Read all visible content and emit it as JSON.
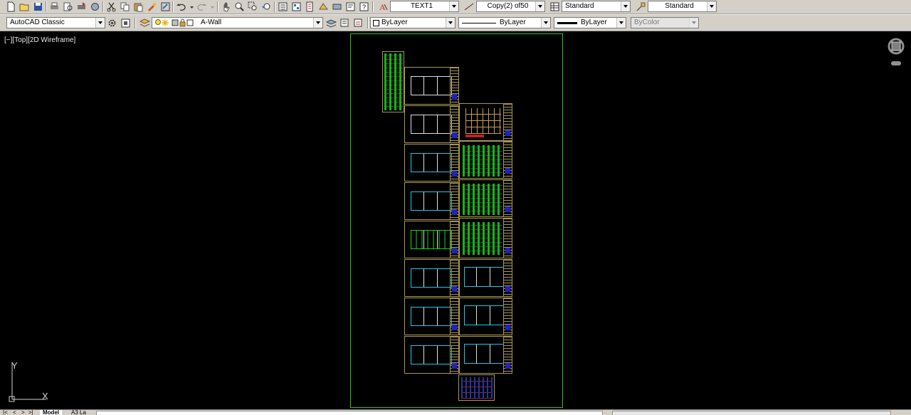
{
  "toolbar1": {
    "text_style": "TEXT1",
    "dim_style": "Copy(2) of50",
    "table_style": "Standard",
    "multileader_style": "Standard"
  },
  "toolbar2": {
    "workspace": "AutoCAD Classic",
    "layer": "A-Wall",
    "color": "ByLayer",
    "linetype": "ByLayer",
    "lineweight": "ByLayer",
    "plotstyle": "ByColor"
  },
  "viewport": {
    "label": "[−][Top][2D Wireframe]"
  },
  "ucs": {
    "x_label": "X",
    "y_label": "Y"
  },
  "tabs": {
    "model": "Model",
    "layout": "A3 La"
  },
  "colors": {
    "sheet_border": "#1ec81e",
    "title_block": "#a89650",
    "green_content": "#20d020",
    "cyan_content": "#20c8e8",
    "toolbar_bg": "#d4d0c8"
  },
  "icons": [
    "new-icon",
    "open-icon",
    "save-icon",
    "print-icon",
    "print-preview-icon",
    "publish-icon",
    "3d-print-icon",
    "cut-icon",
    "copy-icon",
    "paste-icon",
    "match-properties-icon",
    "block-editor-icon",
    "undo-icon",
    "redo-icon",
    "pan-icon",
    "zoom-realtime-icon",
    "zoom-window-icon",
    "zoom-previous-icon",
    "properties-icon",
    "design-center-icon",
    "tool-palettes-icon",
    "sheet-set-icon",
    "markup-icon",
    "quickcalc-icon",
    "calculator-icon",
    "help-icon",
    "text-style-icon",
    "dim-style-icon",
    "table-style-icon",
    "multileader-style-icon"
  ]
}
